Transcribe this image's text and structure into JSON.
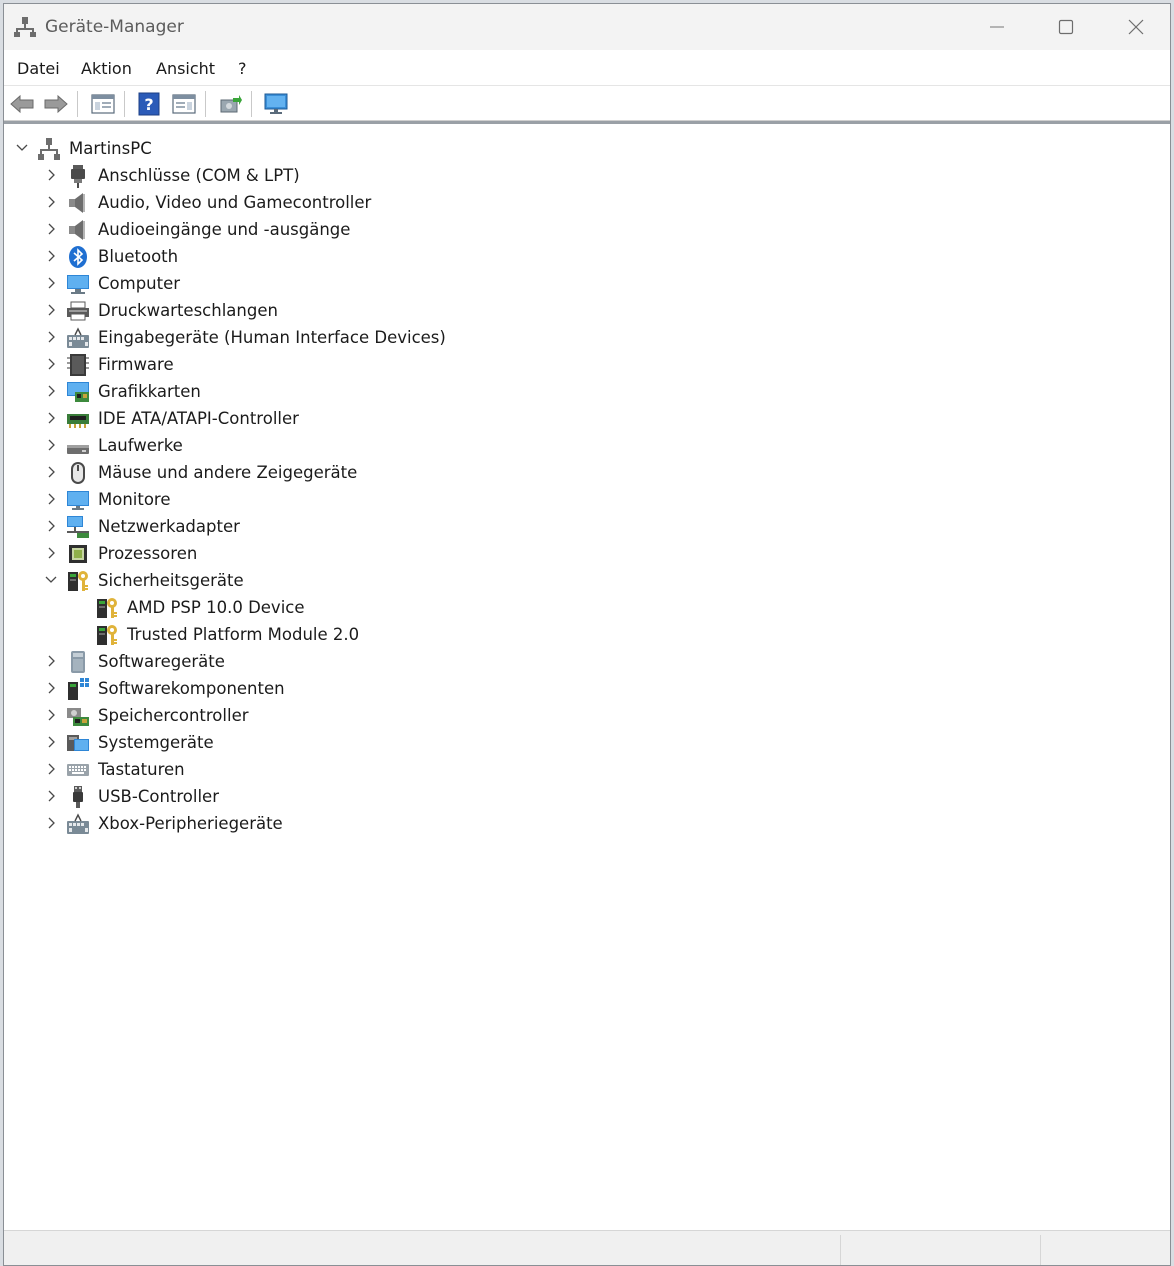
{
  "window": {
    "title": "Geräte-Manager"
  },
  "menu": {
    "items": [
      "Datei",
      "Aktion",
      "Ansicht",
      "?"
    ]
  },
  "toolbar": {
    "buttons": [
      "back-icon",
      "forward-icon",
      "show-hide-console-tree-icon",
      "help-icon",
      "properties-pane-icon",
      "update-driver-icon",
      "scan-hardware-icon"
    ]
  },
  "tree": {
    "root": "MartinsPC",
    "nodes": [
      {
        "label": "Anschlüsse (COM & LPT)",
        "icon": "port-icon",
        "expanded": false
      },
      {
        "label": "Audio, Video und Gamecontroller",
        "icon": "speaker-icon",
        "expanded": false
      },
      {
        "label": "Audioeingänge und -ausgänge",
        "icon": "speaker-icon",
        "expanded": false
      },
      {
        "label": "Bluetooth",
        "icon": "bluetooth-icon",
        "expanded": false
      },
      {
        "label": "Computer",
        "icon": "computer-icon",
        "expanded": false
      },
      {
        "label": "Druckwarteschlangen",
        "icon": "printer-icon",
        "expanded": false
      },
      {
        "label": "Eingabegeräte (Human Interface Devices)",
        "icon": "hid-icon",
        "expanded": false
      },
      {
        "label": "Firmware",
        "icon": "firmware-icon",
        "expanded": false
      },
      {
        "label": "Grafikkarten",
        "icon": "display-adapter-icon",
        "expanded": false
      },
      {
        "label": "IDE ATA/ATAPI-Controller",
        "icon": "ide-controller-icon",
        "expanded": false
      },
      {
        "label": "Laufwerke",
        "icon": "disk-drive-icon",
        "expanded": false
      },
      {
        "label": "Mäuse und andere Zeigegeräte",
        "icon": "mouse-icon",
        "expanded": false
      },
      {
        "label": "Monitore",
        "icon": "monitor-icon",
        "expanded": false
      },
      {
        "label": "Netzwerkadapter",
        "icon": "network-adapter-icon",
        "expanded": false
      },
      {
        "label": "Prozessoren",
        "icon": "processor-icon",
        "expanded": false
      },
      {
        "label": "Sicherheitsgeräte",
        "icon": "security-device-icon",
        "expanded": true,
        "children": [
          {
            "label": "AMD PSP 10.0 Device",
            "icon": "security-device-icon"
          },
          {
            "label": "Trusted Platform Module 2.0",
            "icon": "security-device-icon"
          }
        ]
      },
      {
        "label": "Softwaregeräte",
        "icon": "software-device-icon",
        "expanded": false
      },
      {
        "label": "Softwarekomponenten",
        "icon": "software-component-icon",
        "expanded": false
      },
      {
        "label": "Speichercontroller",
        "icon": "storage-controller-icon",
        "expanded": false
      },
      {
        "label": "Systemgeräte",
        "icon": "system-device-icon",
        "expanded": false
      },
      {
        "label": "Tastaturen",
        "icon": "keyboard-icon",
        "expanded": false
      },
      {
        "label": "USB-Controller",
        "icon": "usb-icon",
        "expanded": false
      },
      {
        "label": "Xbox-Peripheriegeräte",
        "icon": "hid-icon",
        "expanded": false
      }
    ]
  },
  "colors": {
    "accent": "#0078d4",
    "titlebar": "#f3f3f3",
    "statusbar": "#f0f0f0"
  }
}
